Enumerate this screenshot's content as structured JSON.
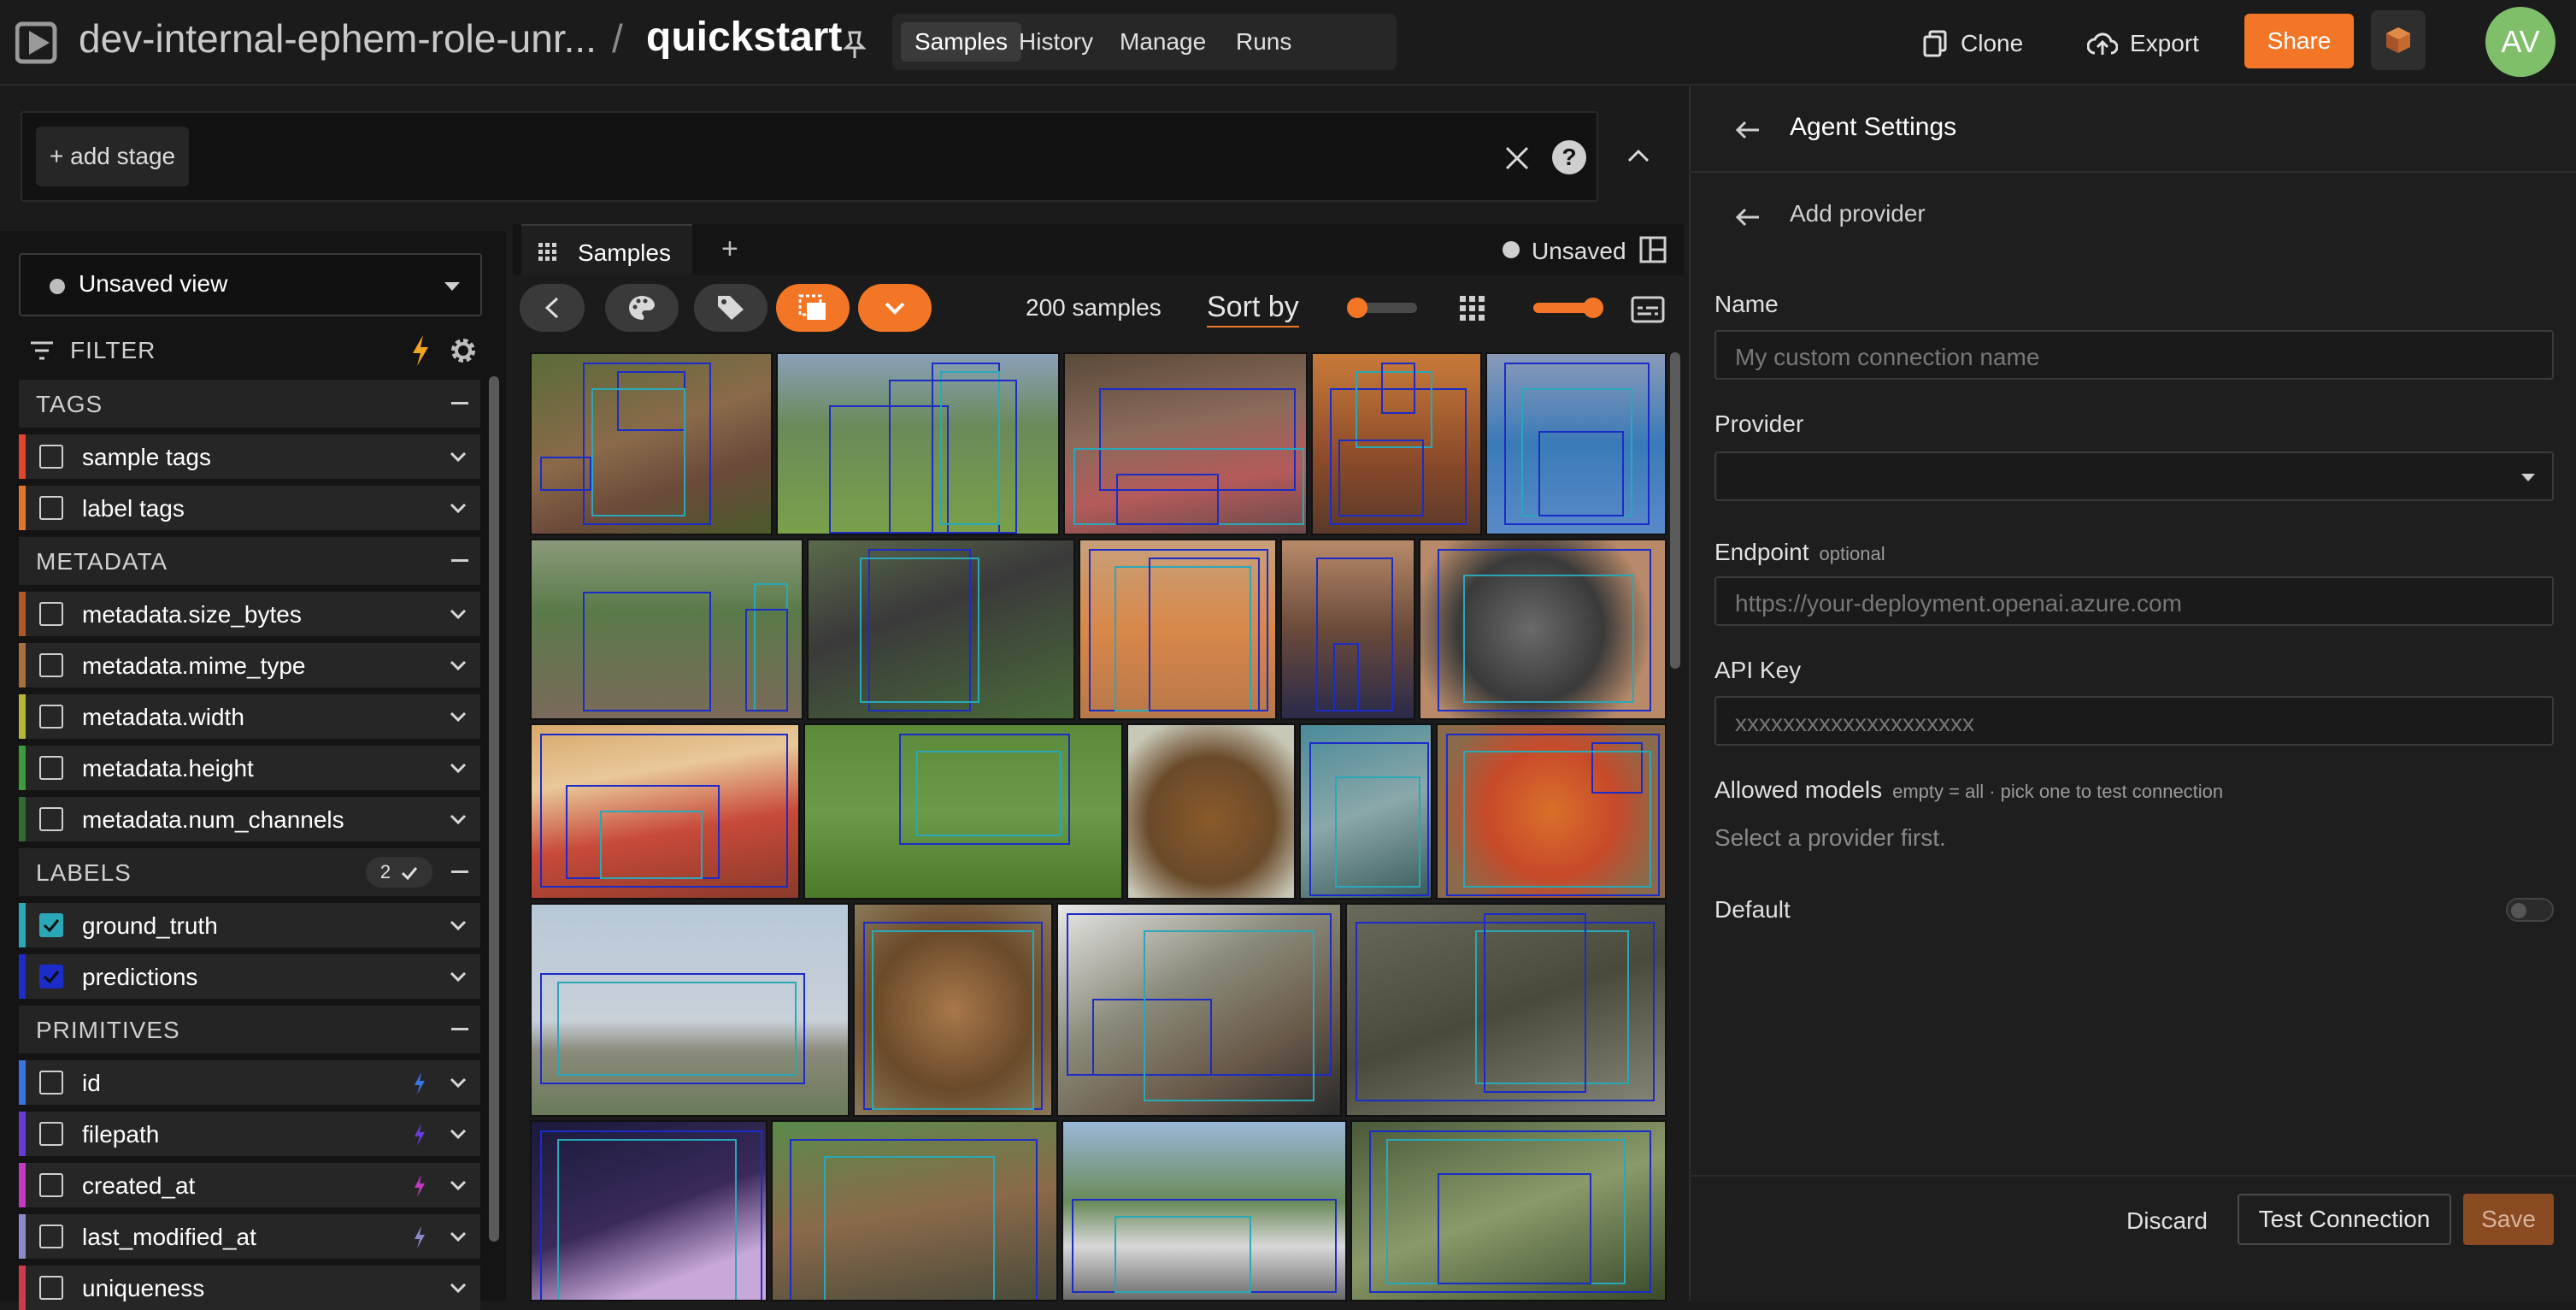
{
  "header": {
    "dataset_name": "dev-internal-ephem-role-unr...",
    "separator": "/",
    "dataset_sub": "quickstart",
    "nav_tabs": [
      "Samples",
      "History",
      "Manage",
      "Runs"
    ],
    "active_tab": "Samples",
    "clone_label": "Clone",
    "export_label": "Export",
    "share_label": "Share",
    "avatar_initials": "AV",
    "accent_color": "#f27625"
  },
  "stage_bar": {
    "add_stage_label": "+ add stage",
    "help_label": "?"
  },
  "sidebar": {
    "view_label": "Unsaved view",
    "filter_label": "FILTER",
    "groups": [
      {
        "title": "TAGS",
        "fields": [
          {
            "label": "sample tags",
            "color": "#e0442e",
            "checked": false
          },
          {
            "label": "label tags",
            "color": "#e2762b",
            "checked": false
          }
        ]
      },
      {
        "title": "METADATA",
        "fields": [
          {
            "label": "metadata.size_bytes",
            "color": "#b4562c",
            "checked": false
          },
          {
            "label": "metadata.mime_type",
            "color": "#a8703c",
            "checked": false
          },
          {
            "label": "metadata.width",
            "color": "#b8b43a",
            "checked": false
          },
          {
            "label": "metadata.height",
            "color": "#3e9a3e",
            "checked": false
          },
          {
            "label": "metadata.num_channels",
            "color": "#2f6b33",
            "checked": false
          }
        ]
      },
      {
        "title": "LABELS",
        "badge": "2",
        "fields": [
          {
            "label": "ground_truth",
            "color": "#2aa8b8",
            "checked": true
          },
          {
            "label": "predictions",
            "color": "#1b2cc8",
            "checked": true
          }
        ]
      },
      {
        "title": "PRIMITIVES",
        "fields": [
          {
            "label": "id",
            "color": "#3a74e0",
            "checked": false,
            "bolt": "#3a74e0"
          },
          {
            "label": "filepath",
            "color": "#6a3ad8",
            "checked": false,
            "bolt": "#6a3ad8"
          },
          {
            "label": "created_at",
            "color": "#c23ac0",
            "checked": false,
            "bolt": "#c23ac0"
          },
          {
            "label": "last_modified_at",
            "color": "#8a8ac8",
            "checked": false,
            "bolt": "#8a8ac8"
          },
          {
            "label": "uniqueness",
            "color": "#d03a4a",
            "checked": false
          }
        ]
      }
    ]
  },
  "grid": {
    "tab_label": "Samples",
    "add_tab": "+",
    "unsaved_label": "Unsaved",
    "sample_count": "200 samples",
    "sort_label": "Sort by"
  },
  "agent_panel": {
    "title": "Agent Settings",
    "subtitle": "Add provider",
    "name_label": "Name",
    "name_placeholder": "My custom connection name",
    "provider_label": "Provider",
    "endpoint_label": "Endpoint",
    "endpoint_optional": "optional",
    "endpoint_placeholder": "https://your-deployment.openai.azure.com",
    "api_key_label": "API Key",
    "api_key_placeholder": "xxxxxxxxxxxxxxxxxxxx",
    "allowed_models_label": "Allowed models",
    "allowed_models_hint": "empty = all · pick one to test connection",
    "select_provider_text": "Select a provider first.",
    "default_label": "Default",
    "default_on": false,
    "discard_label": "Discard",
    "test_label": "Test Connection",
    "save_label": "Save"
  }
}
